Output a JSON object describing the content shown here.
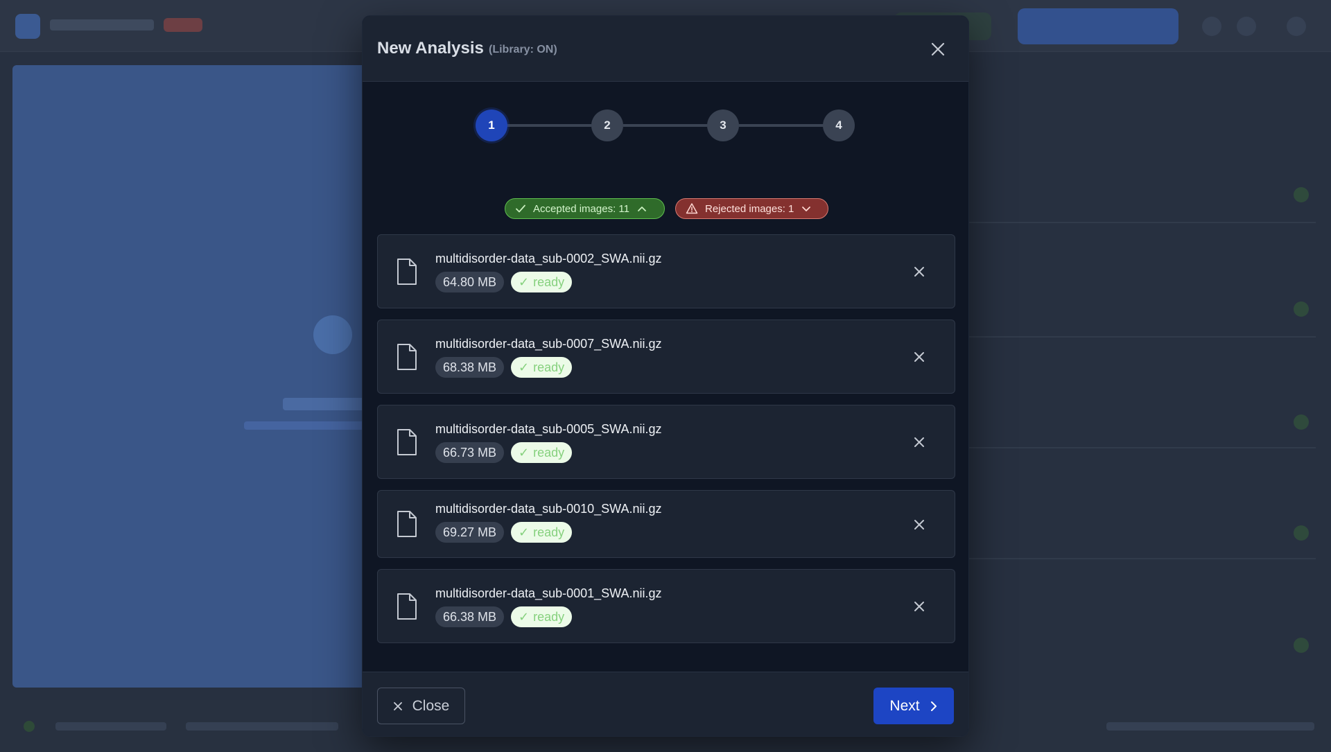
{
  "modal": {
    "title": "New Analysis",
    "subtitle": "(Library: ON)",
    "close_icon": "close-icon"
  },
  "stepper": {
    "steps": [
      "1",
      "2",
      "3",
      "4"
    ],
    "active_step": 1
  },
  "filters": {
    "accepted_label": "Accepted images: 11",
    "rejected_label": "Rejected images: 1",
    "accepted_color": "#2f6b2a",
    "rejected_color": "#84312f"
  },
  "files": [
    {
      "name": "multidisorder-data_sub-0002_SWA.nii.gz",
      "size": "64.80 MB",
      "status": "ready"
    },
    {
      "name": "multidisorder-data_sub-0007_SWA.nii.gz",
      "size": "68.38 MB",
      "status": "ready"
    },
    {
      "name": "multidisorder-data_sub-0005_SWA.nii.gz",
      "size": "66.73 MB",
      "status": "ready"
    },
    {
      "name": "multidisorder-data_sub-0010_SWA.nii.gz",
      "size": "69.27 MB",
      "status": "ready"
    },
    {
      "name": "multidisorder-data_sub-0001_SWA.nii.gz",
      "size": "66.38 MB",
      "status": "ready"
    }
  ],
  "footer": {
    "close_label": "Close",
    "next_label": "Next"
  },
  "colors": {
    "accent": "#1d45c4",
    "status_ready_bg": "#ecfbe8",
    "status_ready_text": "#86d17e"
  }
}
